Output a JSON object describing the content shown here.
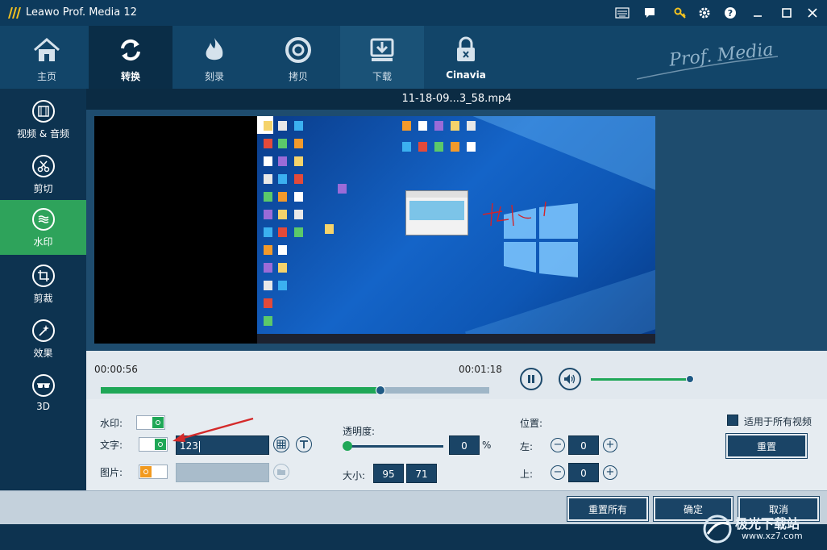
{
  "app": {
    "title": "Leawo Prof. Media 12",
    "brand": "Prof. Media"
  },
  "window_controls": [
    "keyboard-icon",
    "message-icon",
    "key-icon",
    "gear-icon",
    "help-icon",
    "minimize-icon",
    "maximize-icon",
    "close-icon"
  ],
  "nav": {
    "tabs": [
      {
        "label": "主页",
        "icon": "home-icon"
      },
      {
        "label": "转换",
        "icon": "convert-icon",
        "active": true
      },
      {
        "label": "刻录",
        "icon": "burn-icon"
      },
      {
        "label": "拷贝",
        "icon": "copy-disc-icon"
      },
      {
        "label": "下载",
        "icon": "download-icon"
      },
      {
        "label": "Cinavia",
        "icon": "cinavia-lock-icon"
      }
    ]
  },
  "sidebar": {
    "items": [
      {
        "label": "视频 & 音频",
        "icon": "film-icon"
      },
      {
        "label": "剪切",
        "icon": "scissors-icon"
      },
      {
        "label": "水印",
        "icon": "watermark-icon",
        "active": true
      },
      {
        "label": "剪裁",
        "icon": "crop-icon"
      },
      {
        "label": "效果",
        "icon": "effect-icon"
      },
      {
        "label": "3D",
        "icon": "3d-glasses-icon"
      }
    ]
  },
  "file": {
    "name": "11-18-09...3_58.mp4"
  },
  "playback": {
    "current_time": "00:00:56",
    "total_time": "00:01:18",
    "progress_fraction": 0.72,
    "volume_fraction": 1.0
  },
  "settings": {
    "watermark_label": "水印:",
    "watermark_on": true,
    "text_label": "文字:",
    "text_on": true,
    "text_value": "123",
    "image_label": "图片:",
    "image_on": false,
    "image_value": "",
    "opacity_label": "透明度:",
    "opacity_value": "0",
    "opacity_unit": "%",
    "size_label": "大小:",
    "size_w": "95",
    "size_h": "71",
    "position_label": "位置:",
    "left_label": "左:",
    "left_value": "0",
    "top_label": "上:",
    "top_value": "0",
    "apply_all_label": "适用于所有视频",
    "reset_label": "重置"
  },
  "footer": {
    "reset_all": "重置所有",
    "ok": "确定",
    "cancel": "取消"
  },
  "watermark_site": {
    "line1": "极光下载站",
    "line2": "www.xz7.com"
  },
  "colors": {
    "accent_green": "#1fa757",
    "dark_blue": "#1a4466",
    "nav_bg": "#124569"
  }
}
